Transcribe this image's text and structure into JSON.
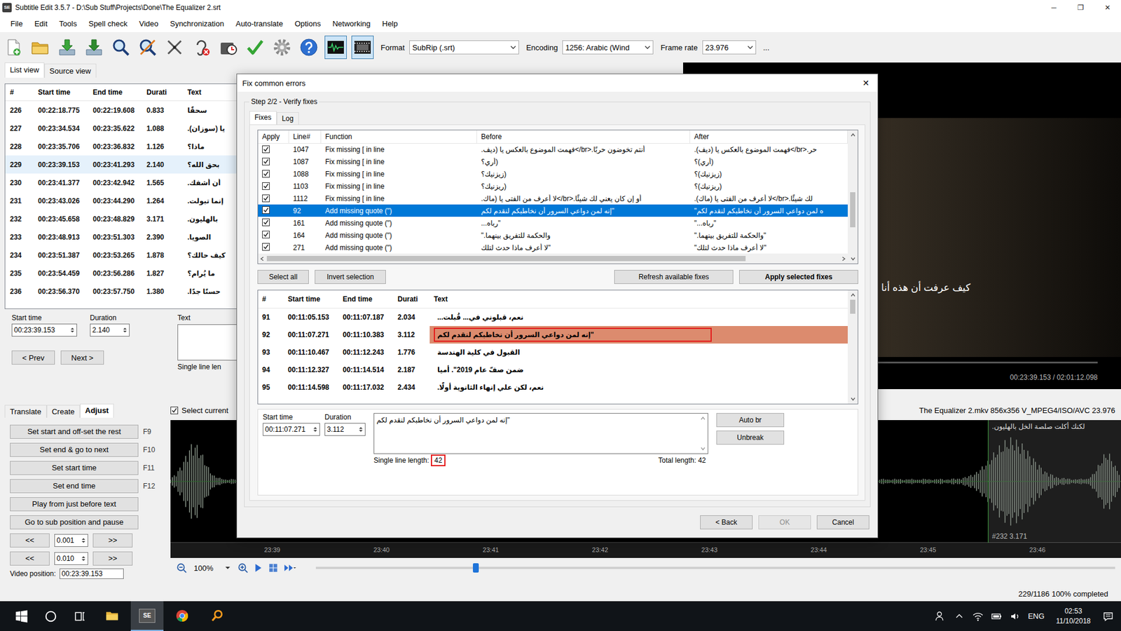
{
  "window": {
    "icon": "SE",
    "title": "Subtitle Edit 3.5.7 - D:\\Sub Stuff\\Projects\\Done\\The Equalizer 2.srt",
    "controls": [
      "─",
      "❐",
      "✕"
    ]
  },
  "menu": [
    "File",
    "Edit",
    "Tools",
    "Spell check",
    "Video",
    "Synchronization",
    "Auto-translate",
    "Options",
    "Networking",
    "Help"
  ],
  "toolbar": {
    "buttons": [
      {
        "pressed": false
      },
      {
        "pressed": false
      },
      {
        "pressed": false
      },
      {
        "pressed": false
      },
      {
        "pressed": false
      },
      {
        "pressed": false
      },
      {
        "pressed": false
      },
      {
        "pressed": false
      },
      {
        "pressed": false
      },
      {
        "pressed": false
      },
      {
        "pressed": false
      },
      {
        "pressed": false
      },
      {
        "pressed": true
      },
      {
        "pressed": true
      }
    ],
    "format": {
      "label": "Format",
      "value": "SubRip (.srt)"
    },
    "encoding": {
      "label": "Encoding",
      "value": "1256: Arabic (Wind"
    },
    "frame_rate": {
      "label": "Frame rate",
      "value": "23.976"
    },
    "more": "..."
  },
  "view_tabs": [
    {
      "label": "List view",
      "selected": true
    },
    {
      "label": "Source view",
      "selected": false
    }
  ],
  "list": {
    "columns": [
      "#",
      "Start time",
      "End time",
      "Durati",
      "Text"
    ],
    "rows": [
      {
        "num": "226",
        "start": "00:22:18.775",
        "end": "00:22:19.608",
        "duration": "0.833",
        "text": "سحقًا",
        "selected": false
      },
      {
        "num": "227",
        "start": "00:23:34.534",
        "end": "00:23:35.622",
        "duration": "1.088",
        "text": "يا (سوزان).",
        "selected": false
      },
      {
        "num": "228",
        "start": "00:23:35.706",
        "end": "00:23:36.832",
        "duration": "1.126",
        "text": "ماذا؟",
        "selected": false
      },
      {
        "num": "229",
        "start": "00:23:39.153",
        "end": "00:23:41.293",
        "duration": "2.140",
        "text": "بحق الله؟",
        "selected": true
      },
      {
        "num": "230",
        "start": "00:23:41.377",
        "end": "00:23:42.942",
        "duration": "1.565",
        "text": "أن أشفك.",
        "selected": false
      },
      {
        "num": "231",
        "start": "00:23:43.026",
        "end": "00:23:44.290",
        "duration": "1.264",
        "text": "إنما تبولت.",
        "selected": false
      },
      {
        "num": "232",
        "start": "00:23:45.658",
        "end": "00:23:48.829",
        "duration": "3.171",
        "text": "بالهليون.",
        "selected": false
      },
      {
        "num": "233",
        "start": "00:23:48.913",
        "end": "00:23:51.303",
        "duration": "2.390",
        "text": "الصويا.",
        "selected": false
      },
      {
        "num": "234",
        "start": "00:23:51.387",
        "end": "00:23:53.265",
        "duration": "1.878",
        "text": "كيف حالك؟",
        "selected": false
      },
      {
        "num": "235",
        "start": "00:23:54.459",
        "end": "00:23:56.286",
        "duration": "1.827",
        "text": "ما يُرام؟",
        "selected": false
      },
      {
        "num": "236",
        "start": "00:23:56.370",
        "end": "00:23:57.750",
        "duration": "1.380",
        "text": "حسنًا جدًا.",
        "selected": false
      }
    ]
  },
  "editor": {
    "start_label": "Start time",
    "start": "00:23:39.153",
    "duration_label": "Duration",
    "duration": "2.140",
    "text_label": "Text",
    "line_length_label": "Single line len",
    "prev": "< Prev",
    "next": "Next >"
  },
  "video": {
    "subtitle": "كيف عرفت أن هذه أنا",
    "time": "00:23:39.153 / 02:01:12.098",
    "level": 0.2,
    "info": "The Equalizer 2.mkv 856x356 V_MPEG4/ISO/AVC 23.976"
  },
  "adjust": {
    "tabs": [
      {
        "label": "Translate",
        "selected": false
      },
      {
        "label": "Create",
        "selected": false
      },
      {
        "label": "Adjust",
        "selected": true
      }
    ],
    "buttons": [
      {
        "label": "Set start and off-set the rest",
        "key": "F9"
      },
      {
        "label": "Set end & go to next",
        "key": "F10"
      },
      {
        "label": "Set start time",
        "key": "F11"
      },
      {
        "label": "Set end time",
        "key": "F12"
      },
      {
        "label": "Play from just before text"
      },
      {
        "label": "Go to sub position and pause"
      }
    ],
    "steps": [
      {
        "back": "<<",
        "value": "0.001",
        "forward": ">>"
      },
      {
        "back": "<<",
        "value": "0.010",
        "forward": ">>"
      }
    ],
    "video_position": {
      "label": "Video position:",
      "value": "00:23:39.153"
    }
  },
  "waveform": {
    "select_current": {
      "label": "Select current",
      "checked": true
    },
    "ticks": [
      "23:39",
      "23:40",
      "23:41",
      "23:42",
      "23:43",
      "23:44",
      "23:45",
      "23:46"
    ],
    "paragraph": {
      "label": "#232 3.171",
      "text": "لكنك أكلت صلصة الخل بالهليون."
    },
    "zoom": "100%",
    "level": 0.2
  },
  "status": "229/1186 100% completed",
  "dialog": {
    "title": "Fix common errors",
    "close": "✕",
    "step": "Step 2/2 - Verify fixes",
    "tabs": [
      {
        "label": "Fixes",
        "selected": true
      },
      {
        "label": "Log",
        "selected": false
      }
    ],
    "fixes": {
      "columns": [
        "Apply",
        "Line#",
        "Function",
        "Before",
        "After"
      ],
      "rows": [
        {
          "apply": true,
          "line": "1047",
          "function": "Fix missing [ in line",
          "before": "أنتم تخوضون حربًا.<br/>فهمت الموضوع بالعكس يا (ديف.",
          "after": "حر.<br/>فهمت الموضوع بالعكس يا (ديف).",
          "selected": false
        },
        {
          "apply": true,
          "line": "1087",
          "function": "Fix missing [ in line",
          "before": "(أري؟",
          "after": "(أري)؟",
          "selected": false
        },
        {
          "apply": true,
          "line": "1088",
          "function": "Fix missing [ in line",
          "before": "(زيزنيك؟",
          "after": "(زيزنيك)؟",
          "selected": false
        },
        {
          "apply": true,
          "line": "1103",
          "function": "Fix missing [ in line",
          "before": "(ريزنيك؟",
          "after": "(ريزنيك)؟",
          "selected": false
        },
        {
          "apply": true,
          "line": "1112",
          "function": "Fix missing [ in line",
          "before": "أو إن كان يعني لك شيئًا.<br/>لا أعرف من الفتى يا (ماك.",
          "after": "لك شيئًا.<br/>لا أعرف من الفتى يا (ماك).",
          "selected": false
        },
        {
          "apply": true,
          "line": "92",
          "function": "Add missing quote (\")",
          "before": "\"إنه لمن دواعي السرور أن نخاطبكم لنقدم لكم",
          "after": "ه لمن دواعي السرور أن نخاطبكم لنقدم لكم\"",
          "selected": true
        },
        {
          "apply": true,
          "line": "161",
          "function": "Add missing quote (\")",
          "before": "\"رباه...",
          "after": "\"رباه...\"",
          "selected": false
        },
        {
          "apply": true,
          "line": "164",
          "function": "Add missing quote (\")",
          "before": "والحكمة للتفريق بينهما.\"",
          "after": "\"والحكمة للتفريق بينهما.\"",
          "selected": false
        },
        {
          "apply": true,
          "line": "271",
          "function": "Add missing quote (\")",
          "before": "\"لا أعرف ماذا حدث لتلك",
          "after": "\"لا أعرف ماذا حدث لتلك\"",
          "selected": false
        }
      ]
    },
    "buttons": {
      "select_all": "Select all",
      "invert": "Invert selection",
      "refresh": "Refresh available fixes",
      "apply": "Apply selected fixes"
    },
    "preview": {
      "columns": [
        "#",
        "Start time",
        "End time",
        "Durati",
        "Text"
      ],
      "rows": [
        {
          "num": "91",
          "start": "00:11:05.153",
          "end": "00:11:07.187",
          "duration": "2.034",
          "text": "نعم، قبلوني في... قُبلت...",
          "selected": false,
          "fixed": false,
          "marked": false
        },
        {
          "num": "92",
          "start": "00:11:07.271",
          "end": "00:11:10.383",
          "duration": "3.112",
          "text": "\"إنه لمن دواعي السرور أن نخاطبكم لنقدم لكم",
          "selected": true,
          "fixed": true,
          "marked": true
        },
        {
          "num": "93",
          "start": "00:11:10.467",
          "end": "00:11:12.243",
          "duration": "1.776",
          "text": "القبول في كلية الهندسة",
          "selected": false,
          "fixed": false,
          "marked": false
        },
        {
          "num": "94",
          "start": "00:11:12.327",
          "end": "00:11:14.514",
          "duration": "2.187",
          "text": "ضمن صفّ عام 2019\". أميا",
          "selected": false,
          "fixed": false,
          "marked": false
        },
        {
          "num": "95",
          "start": "00:11:14.598",
          "end": "00:11:17.032",
          "duration": "2.434",
          "text": "نعم، لكن علي إنهاء الثانوية أولًا.",
          "selected": false,
          "fixed": false,
          "marked": false
        }
      ]
    },
    "edit": {
      "start_label": "Start time",
      "start": "00:11:07.271",
      "duration_label": "Duration",
      "duration": "3.112",
      "text": "\"إنه لمن دواعي السرور أن نخاطبكم لنقدم لكم",
      "auto_br": "Auto br",
      "unbreak": "Unbreak",
      "single_label": "Single line length:",
      "single_value": "42",
      "single_marked": true,
      "total": "Total length: 42"
    },
    "footer": [
      {
        "label": "< Back",
        "disabled": false
      },
      {
        "label": "OK",
        "disabled": true
      },
      {
        "label": "Cancel",
        "disabled": false
      }
    ]
  },
  "taskbar": {
    "app_label": "SE",
    "language": "ENG",
    "time": "02:53",
    "date": "11/10/2018"
  }
}
